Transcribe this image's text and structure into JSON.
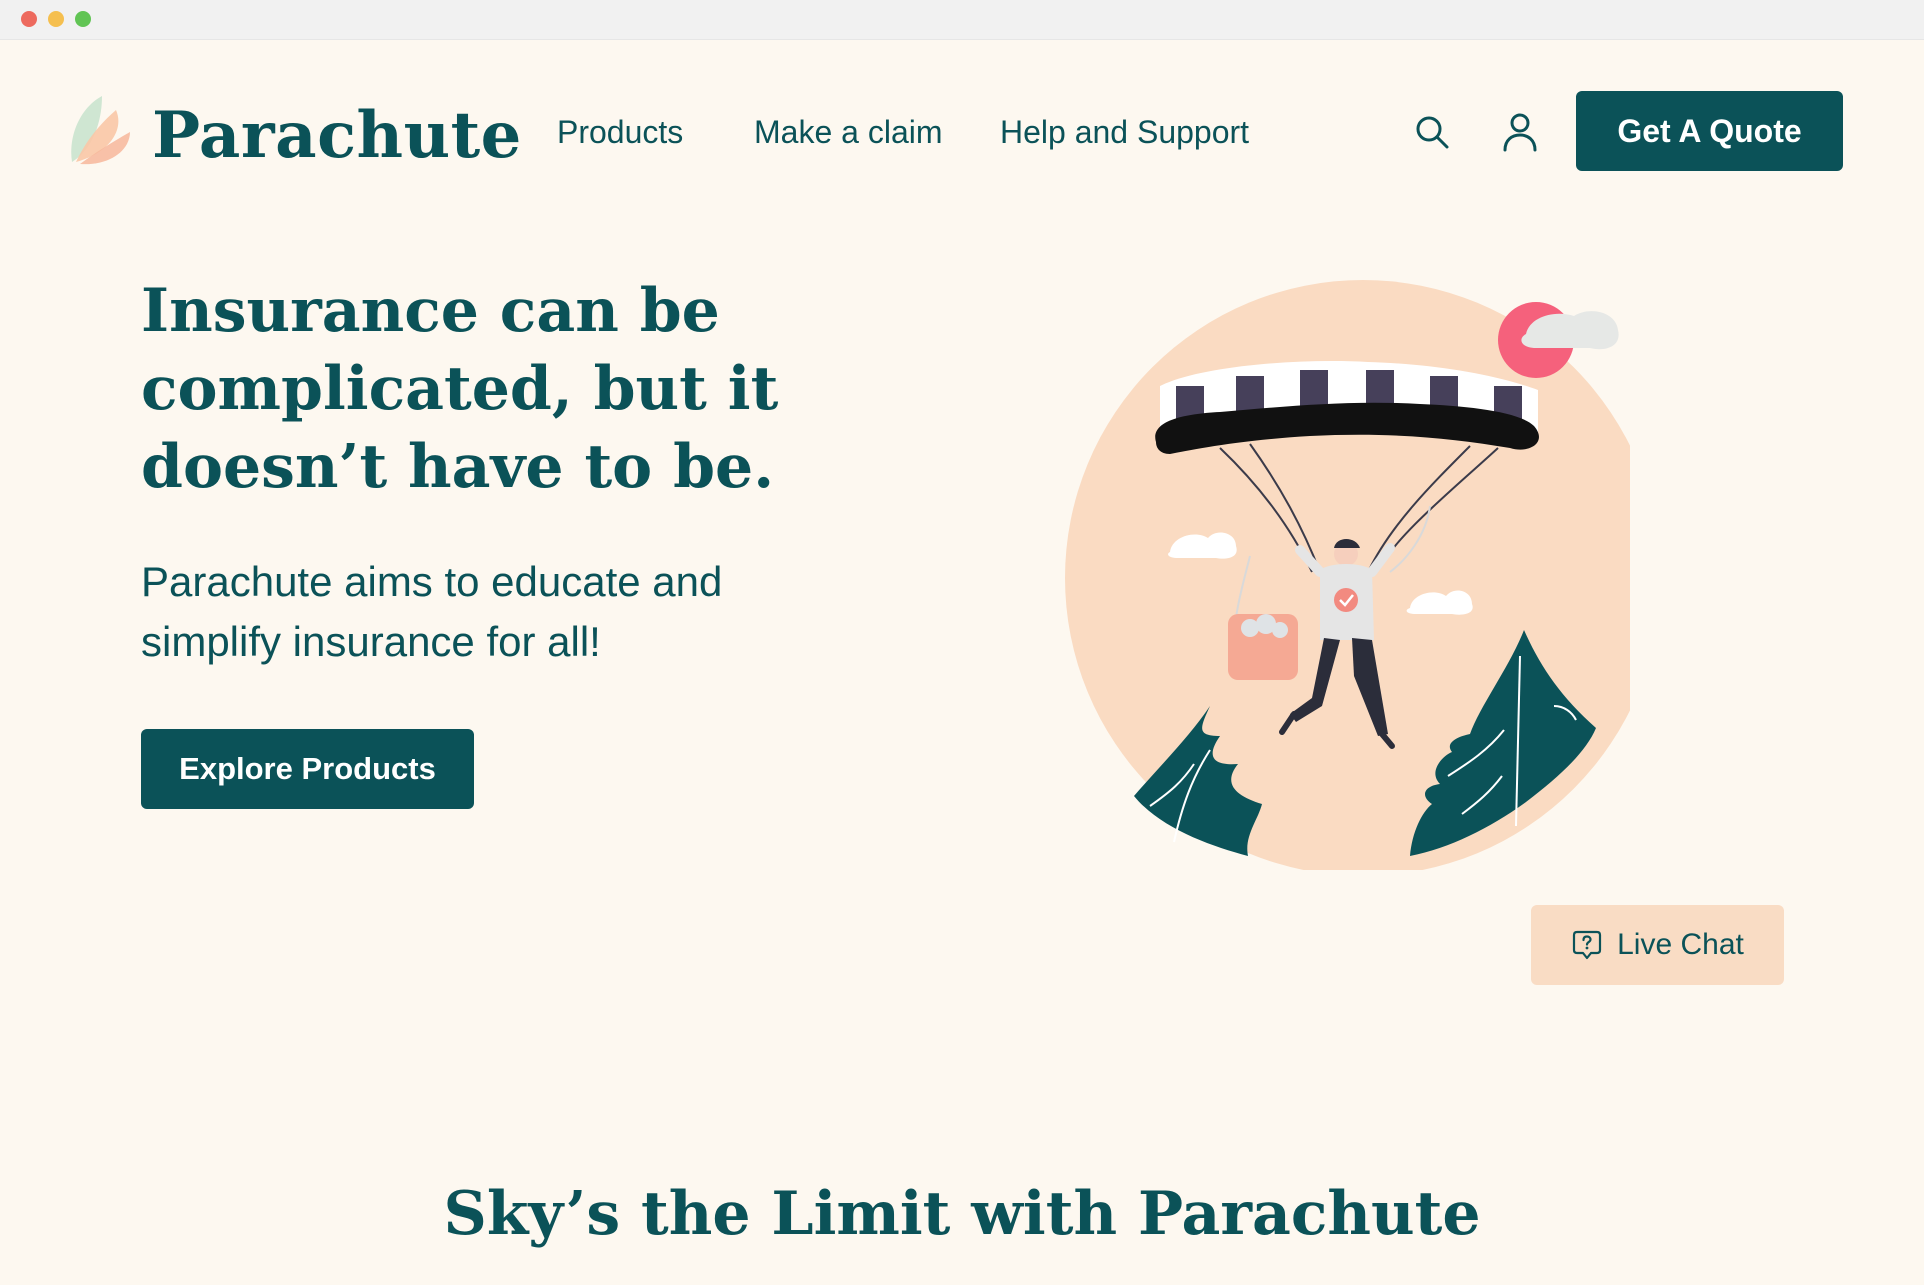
{
  "window": {
    "controls": [
      "close",
      "minimize",
      "maximize"
    ]
  },
  "brand": {
    "name": "Parachute",
    "logo_icon": "leaf-petals-logo"
  },
  "nav": {
    "items": [
      {
        "label": "Products"
      },
      {
        "label": "Make a claim"
      },
      {
        "label": "Help and Support"
      }
    ],
    "search_icon": "search-icon",
    "account_icon": "user-icon",
    "cta_label": "Get A Quote"
  },
  "hero": {
    "title": "Insurance can be complicated, but it doesn’t have to be.",
    "subtitle": "Parachute aims to educate and simplify insurance for all!",
    "button_label": "Explore Products",
    "illustration": "parachute-person-illustration"
  },
  "chat": {
    "label": "Live Chat",
    "icon": "chat-question-icon"
  },
  "section": {
    "title": "Sky’s the Limit with Parachute"
  },
  "colors": {
    "primary": "#0b5258",
    "background": "#fdf8f0",
    "accent_peach": "#f9dcc4",
    "accent_pink": "#f5617c"
  }
}
